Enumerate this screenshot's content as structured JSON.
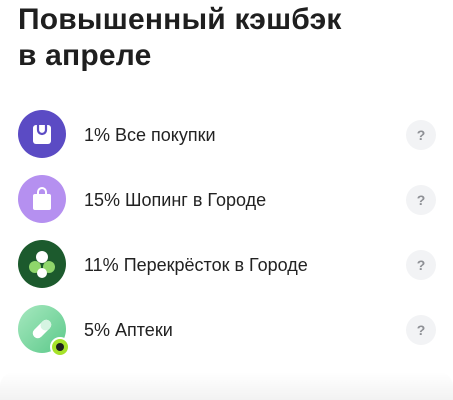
{
  "header": {
    "title_line1": "Повышенный кэшбэк",
    "title_line2": "в апреле"
  },
  "cashback_items": [
    {
      "label": "1% Все покупки",
      "icon": "shopping-bag-icon",
      "color": "#5b4bc4",
      "help": "?"
    },
    {
      "label": "15% Шопинг в Городе",
      "icon": "shopping-bag-icon",
      "color": "#b590f0",
      "help": "?"
    },
    {
      "label": "11% Перекрёсток в Городе",
      "icon": "clover-icon",
      "color": "#1c5a2d",
      "help": "?"
    },
    {
      "label": "5% Аптеки",
      "icon": "pill-icon",
      "color": "#7fd8a0",
      "help": "?"
    }
  ]
}
